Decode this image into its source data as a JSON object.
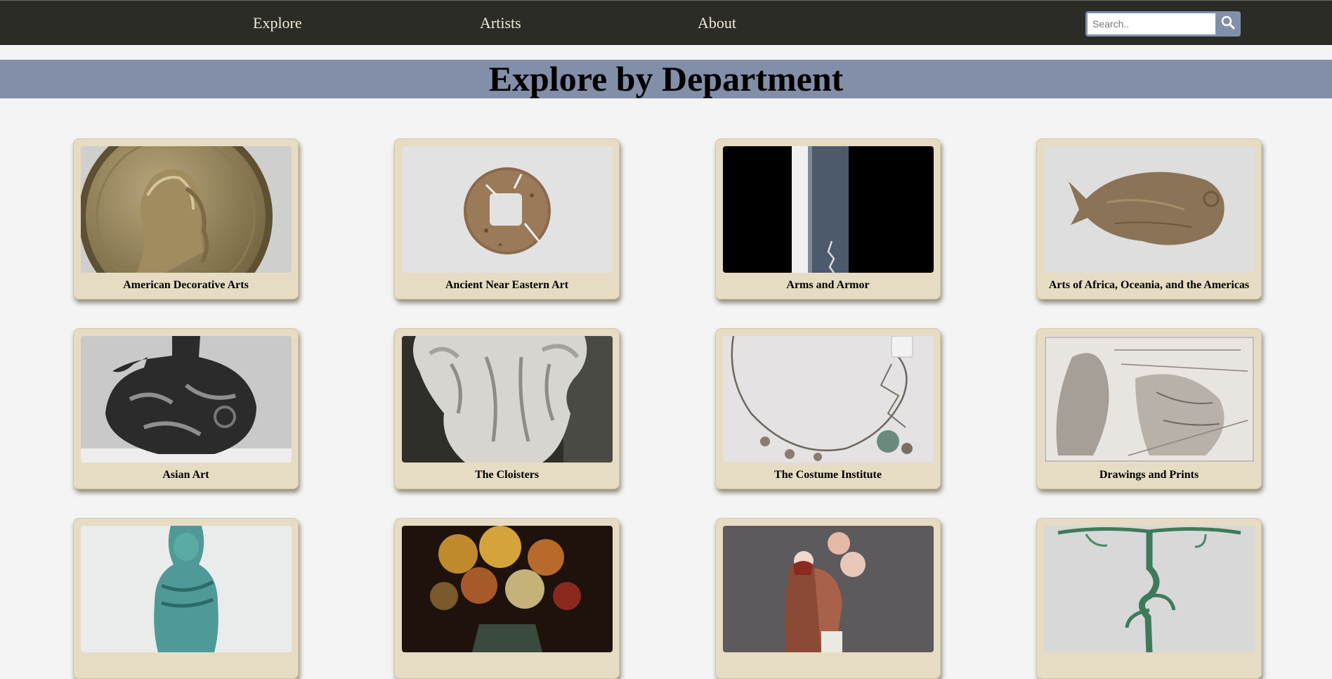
{
  "nav": {
    "links": [
      "Explore",
      "Artists",
      "About"
    ],
    "search_placeholder": "Search..",
    "search_icon": "search-icon"
  },
  "page": {
    "title": "Explore by Department"
  },
  "departments": [
    {
      "name": "American Decorative Arts",
      "image": "franklin-medal"
    },
    {
      "name": "Ancient Near Eastern Art",
      "image": "bronze-coin"
    },
    {
      "name": "Arms and Armor",
      "image": "blade"
    },
    {
      "name": "Arts of Africa, Oceania, and the Americas",
      "image": "fish-pendant"
    },
    {
      "name": "Asian Art",
      "image": "ceramic-ewer"
    },
    {
      "name": "The Cloisters",
      "image": "stone-capital"
    },
    {
      "name": "The Costume Institute",
      "image": "necklace"
    },
    {
      "name": "Drawings and Prints",
      "image": "etching"
    },
    {
      "name": "",
      "image": "faience-shabti"
    },
    {
      "name": "",
      "image": "flower-still-life"
    },
    {
      "name": "",
      "image": "porcelain-figure"
    },
    {
      "name": "",
      "image": "bronze-stand"
    }
  ]
}
